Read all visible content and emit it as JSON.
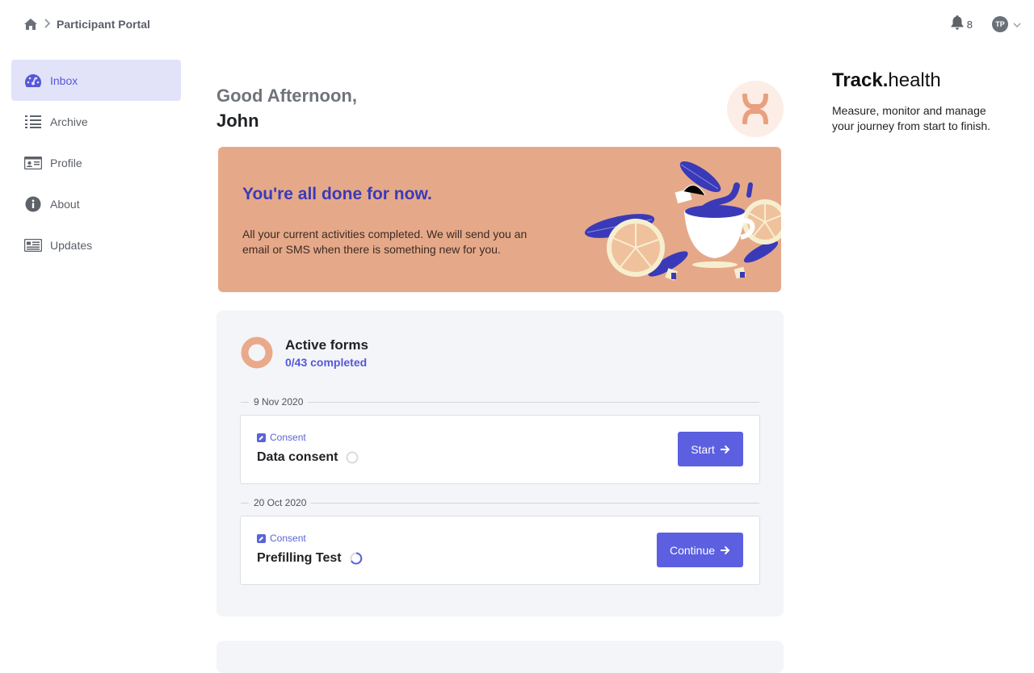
{
  "breadcrumb": {
    "home_icon": "home-icon",
    "separator_icon": "chevron-right-icon",
    "current": "Participant Portal"
  },
  "header": {
    "notifications_count": "8",
    "bell_icon": "bell-icon",
    "avatar_initials": "TP",
    "avatar_menu_icon": "chevron-down-icon"
  },
  "sidebar": {
    "items": [
      {
        "label": "Inbox",
        "icon": "dashboard-icon",
        "active": true
      },
      {
        "label": "Archive",
        "icon": "list-icon",
        "active": false
      },
      {
        "label": "Profile",
        "icon": "id-card-icon",
        "active": false
      },
      {
        "label": "About",
        "icon": "info-icon",
        "active": false
      },
      {
        "label": "Updates",
        "icon": "newspaper-icon",
        "active": false
      }
    ]
  },
  "greeting": {
    "line1": "Good Afternoon,",
    "line2": "John"
  },
  "banner": {
    "title": "You're all done for now.",
    "text": "All your current activities completed. We will send you an email or SMS when there is something new for you."
  },
  "active_forms": {
    "title": "Active forms",
    "progress": "0/43 completed",
    "completed": 0,
    "total": 43,
    "groups": [
      {
        "date": "9 Nov 2020",
        "item": {
          "tag": "Consent",
          "name": "Data consent",
          "button": "Start",
          "status": "not-started"
        }
      },
      {
        "date": "20 Oct 2020",
        "item": {
          "tag": "Consent",
          "name": "Prefilling Test",
          "button": "Continue",
          "status": "in-progress"
        }
      }
    ]
  },
  "promo": {
    "brand_bold": "Track.",
    "brand_light": "health",
    "text": "Measure, monitor and manage your journey from start to finish."
  },
  "colors": {
    "accent": "#5b5fe0",
    "banner_bg": "#e5a98a",
    "sidebar_active_bg": "#e2e3f8"
  }
}
